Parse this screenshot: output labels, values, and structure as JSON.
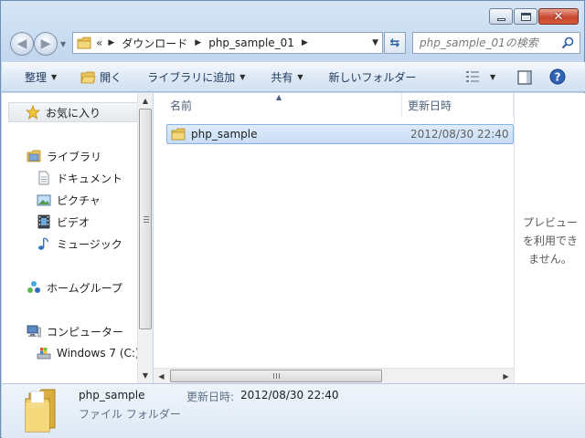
{
  "window": {
    "controls": {
      "minimize": "",
      "maximize": "",
      "close": "✕"
    }
  },
  "address": {
    "chevron": "«",
    "crumbs": [
      "ダウンロード",
      "php_sample_01"
    ]
  },
  "search": {
    "placeholder": "php_sample_01の検索"
  },
  "commands": {
    "organize": "整理",
    "open": "開く",
    "add_to_library": "ライブラリに追加",
    "share": "共有",
    "new_folder": "新しいフォルダー"
  },
  "navpane": {
    "favorites": "お気に入り",
    "libraries": "ライブラリ",
    "documents": "ドキュメント",
    "pictures": "ピクチャ",
    "videos": "ビデオ",
    "music": "ミュージック",
    "homegroup": "ホームグループ",
    "computer": "コンピューター",
    "drive": "Windows 7 (C:)"
  },
  "filelist": {
    "columns": {
      "name": "名前",
      "modified": "更新日時"
    },
    "rows": [
      {
        "name": "php_sample",
        "modified": "2012/08/30 22:40"
      }
    ]
  },
  "preview": {
    "text": "プレビュー\nを利用でき\nません。"
  },
  "details": {
    "name": "php_sample",
    "date_label": "更新日時:",
    "date": "2012/08/30 22:40",
    "type": "ファイル フォルダー"
  },
  "colors": {
    "folder": "#e8c35a",
    "selection": "#c7ddf5",
    "command_text": "#1e395b"
  }
}
